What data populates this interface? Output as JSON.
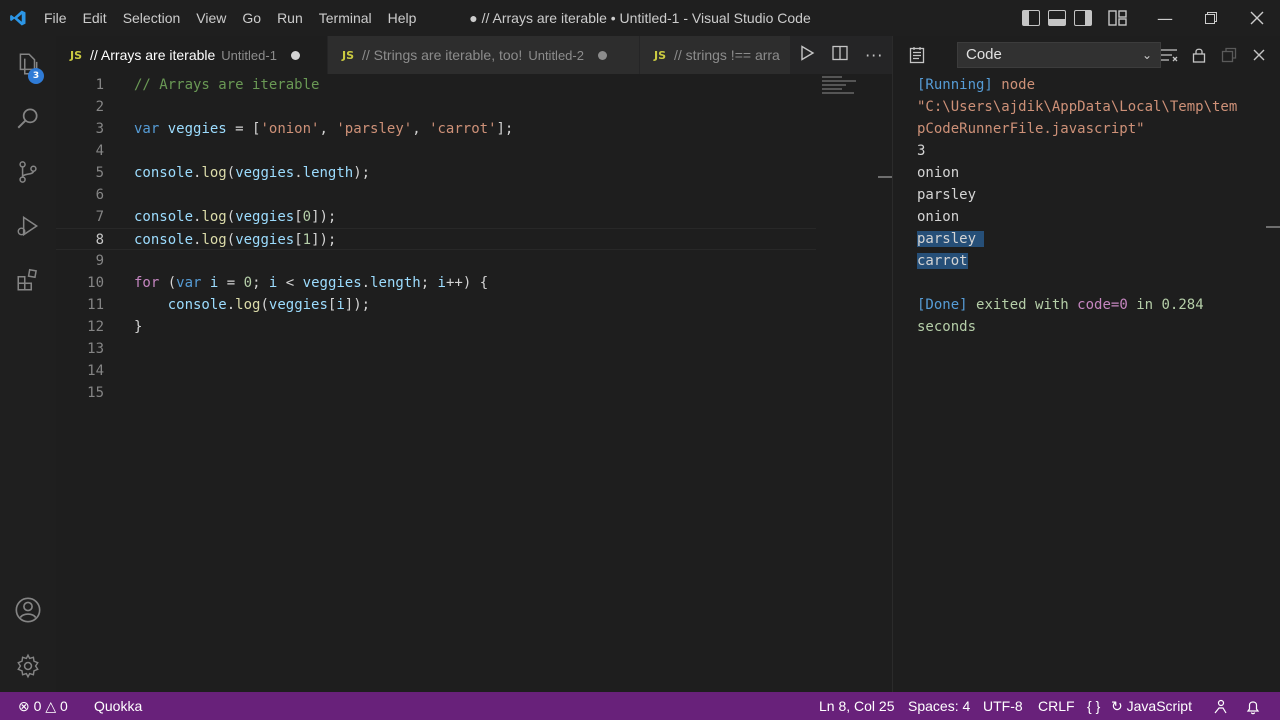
{
  "window": {
    "title": "● // Arrays are iterable • Untitled-1 - Visual Studio Code"
  },
  "menu": [
    "File",
    "Edit",
    "Selection",
    "View",
    "Go",
    "Run",
    "Terminal",
    "Help"
  ],
  "activity": {
    "explorer_badge": "3"
  },
  "tabs": [
    {
      "icon": "JS",
      "title": "// Arrays are iterable",
      "desc": "Untitled-1",
      "active": true
    },
    {
      "icon": "JS",
      "title": "// Strings are iterable, too!",
      "desc": "Untitled-2",
      "active": false
    },
    {
      "icon": "JS",
      "title": "// strings !== arra",
      "desc": "",
      "active": false
    }
  ],
  "editor": {
    "current_line": 8,
    "line_numbers": [
      "1",
      "2",
      "3",
      "4",
      "5",
      "6",
      "7",
      "8",
      "9",
      "10",
      "11",
      "12",
      "13",
      "14",
      "15"
    ]
  },
  "panel": {
    "dropdown_label": "Code",
    "output": {
      "running_tag": "[Running]",
      "running_cmd": "node",
      "path_line1": "\"C:\\Users\\ajdik\\AppData\\Local\\Temp\\tem",
      "path_line2": "pCodeRunnerFile.javascript\"",
      "results": [
        "3",
        "onion",
        "parsley",
        "onion",
        "parsley",
        "carrot"
      ],
      "done_tag": "[Done]",
      "exited_with": "exited with",
      "code_label": "code=0",
      "in_word": "in",
      "duration": "0.284",
      "seconds": "seconds"
    }
  },
  "status": {
    "errors": "0",
    "warnings": "0",
    "quokka": "Quokka",
    "position": "Ln 8, Col 25",
    "spaces": "Spaces: 4",
    "encoding": "UTF-8",
    "eol": "CRLF",
    "braces": "{ }",
    "language": "JavaScript"
  },
  "colors": {
    "statusbar": "#68217a",
    "accent": "#007acc",
    "js_icon": "#cbcb41"
  }
}
